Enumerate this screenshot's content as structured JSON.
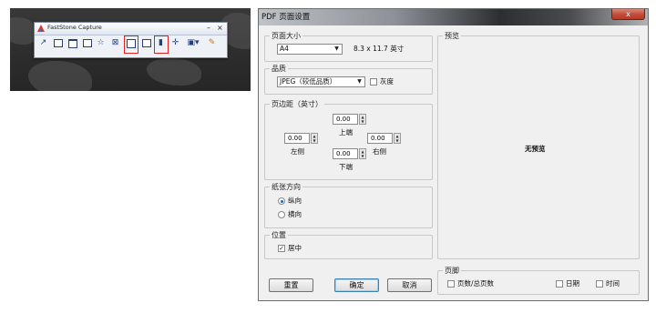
{
  "toolbar": {
    "title": "FastStone Capture",
    "minimize_glyph": "–",
    "close_glyph": "×",
    "icons": [
      "open-file-icon",
      "capture-active-window-icon",
      "capture-window-object-icon",
      "capture-rectangle-icon",
      "capture-freehand-icon",
      "capture-fullscreen-icon",
      "capture-scrolling-window-icon",
      "capture-fixed-region-icon",
      "capture-video-icon",
      "screen-crosshair-icon",
      "output-destination-icon",
      "settings-icon"
    ]
  },
  "dialog": {
    "title": "PDF 页面设置",
    "close_glyph": "x",
    "page_size": {
      "label": "页面大小",
      "value": "A4",
      "dimensions": "8.3 x 11.7 英寸"
    },
    "quality": {
      "label": "品质",
      "value": "JPEG（较低品质）",
      "grayscale_label": "灰度"
    },
    "margins": {
      "label": "页边距（英寸）",
      "top": {
        "value": "0.00",
        "label": "上端"
      },
      "left": {
        "value": "0.00",
        "label": "左侧"
      },
      "right": {
        "value": "0.00",
        "label": "右侧"
      },
      "bottom": {
        "value": "0.00",
        "label": "下端"
      }
    },
    "orientation": {
      "label": "纸张方向",
      "portrait": "纵向",
      "landscape": "横向",
      "selected": "portrait"
    },
    "position": {
      "label": "位置",
      "center_label": "居中",
      "center_checked": true
    },
    "preview": {
      "label": "预览",
      "empty_text": "无预览"
    },
    "footer": {
      "label": "页脚",
      "page_count": "页数/总页数",
      "date": "日期",
      "time": "时间"
    },
    "buttons": {
      "reset": "重置",
      "ok": "确定",
      "cancel": "取消"
    }
  }
}
